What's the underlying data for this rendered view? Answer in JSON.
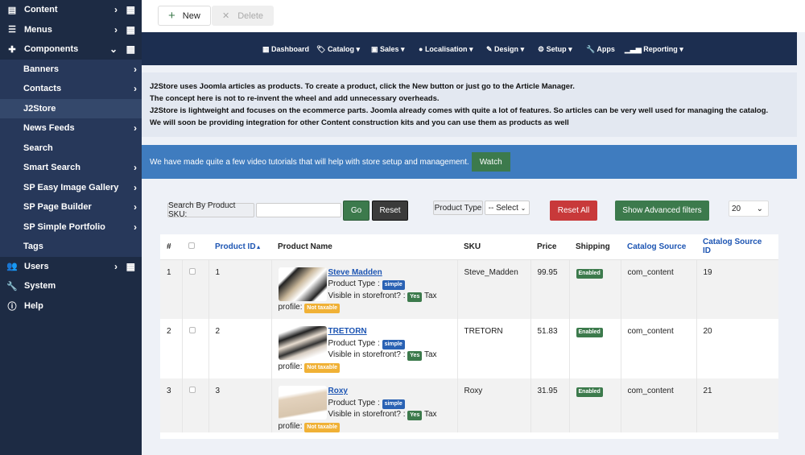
{
  "sidebar": {
    "items": [
      {
        "label": "Content",
        "icon": "file-icon"
      },
      {
        "label": "Menus",
        "icon": "list-icon"
      },
      {
        "label": "Components",
        "icon": "puzzle-icon"
      }
    ],
    "sub": [
      "Banners",
      "Contacts",
      "J2Store",
      "News Feeds",
      "Search",
      "Smart Search",
      "SP Easy Image Gallery",
      "SP Page Builder",
      "SP Simple Portfolio",
      "Tags"
    ],
    "bottom": [
      {
        "label": "Users",
        "icon": "users-icon"
      },
      {
        "label": "System",
        "icon": "wrench-icon"
      },
      {
        "label": "Help",
        "icon": "info-icon"
      }
    ]
  },
  "toolbar": {
    "new": "New",
    "delete": "Delete"
  },
  "nav": [
    "Dashboard",
    "Catalog",
    "Sales",
    "Localisation",
    "Design",
    "Setup",
    "Apps",
    "Reporting"
  ],
  "info": [
    "J2Store uses Joomla articles as products. To create a product, click the New button or just go to the Article Manager.",
    "The concept here is not to re-invent the wheel and add unnecessary overheads.",
    "J2Store is lightweight and focuses on the ecommerce parts. Joomla already comes with quite a lot of features. So articles can be very well used for managing the catalog.",
    "We will soon be providing integration for other Content construction kits and you can use them as products as well"
  ],
  "banner": {
    "text": "We have made quite a few video tutorials that will help with store setup and management.",
    "watch": "Watch"
  },
  "filters": {
    "sku_label": "Search By Product SKU:",
    "sku_value": "",
    "go": "Go",
    "reset": "Reset",
    "type_label": "Product Type",
    "type_select": "-- Select",
    "reset_all": "Reset All",
    "advanced": "Show Advanced filters",
    "limit": "20"
  },
  "table": {
    "headers": [
      "#",
      "Product ID",
      "Product Name",
      "SKU",
      "Price",
      "Shipping",
      "Catalog Source",
      "Catalog Source ID"
    ],
    "labels": {
      "type": "Product Type :",
      "visible": "Visible in storefront? :",
      "tax": "Tax profile:"
    },
    "rows": [
      {
        "n": "1",
        "id": "1",
        "name": "Steve Madden",
        "type": "simple",
        "visible": "Yes",
        "tax": "Not taxable",
        "sku": "Steve_Madden",
        "price": "99.95",
        "shipping": "Enabled",
        "source": "com_content",
        "source_id": "19"
      },
      {
        "n": "2",
        "id": "2",
        "name": "TRETORN",
        "type": "simple",
        "visible": "Yes",
        "tax": "Not taxable",
        "sku": "TRETORN",
        "price": "51.83",
        "shipping": "Enabled",
        "source": "com_content",
        "source_id": "20"
      },
      {
        "n": "3",
        "id": "3",
        "name": "Roxy",
        "type": "simple",
        "visible": "Yes",
        "tax": "Not taxable",
        "sku": "Roxy",
        "price": "31.95",
        "shipping": "Enabled",
        "source": "com_content",
        "source_id": "21"
      }
    ]
  }
}
